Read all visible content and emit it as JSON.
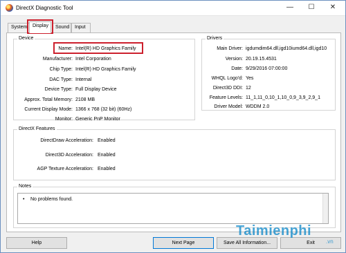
{
  "window": {
    "title": "DirectX Diagnostic Tool",
    "controls": {
      "minimize": "—",
      "maximize": "☐",
      "close": "✕"
    }
  },
  "tabs": [
    {
      "label": "System"
    },
    {
      "label": "Display",
      "active": true
    },
    {
      "label": "Sound"
    },
    {
      "label": "Input"
    }
  ],
  "device": {
    "title": "Device",
    "rows": [
      {
        "label": "Name:",
        "value": "Intel(R) HD Graphics Family"
      },
      {
        "label": "Manufacturer:",
        "value": "Intel Corporation"
      },
      {
        "label": "Chip Type:",
        "value": "Intel(R) HD Graphics Family"
      },
      {
        "label": "DAC Type:",
        "value": "Internal"
      },
      {
        "label": "Device Type:",
        "value": "Full Display Device"
      },
      {
        "label": "Approx. Total Memory:",
        "value": "2108 MB"
      },
      {
        "label": "Current Display Mode:",
        "value": "1366 x 768 (32 bit) (60Hz)"
      },
      {
        "label": "Monitor:",
        "value": "Generic PnP Monitor"
      }
    ]
  },
  "drivers": {
    "title": "Drivers",
    "rows": [
      {
        "label": "Main Driver:",
        "value": "igdumdim64.dll,igd10iumd64.dll,igd10"
      },
      {
        "label": "Version:",
        "value": "20.19.15.4531"
      },
      {
        "label": "Date:",
        "value": "9/29/2016 07:00:00"
      },
      {
        "label": "WHQL Logo'd:",
        "value": "Yes"
      },
      {
        "label": "Direct3D DDI:",
        "value": "12"
      },
      {
        "label": "Feature Levels:",
        "value": "11_1,11_0,10_1,10_0,9_3,9_2,9_1"
      },
      {
        "label": "Driver Model:",
        "value": "WDDM 2.0"
      }
    ]
  },
  "features": {
    "title": "DirectX Features",
    "rows": [
      {
        "label": "DirectDraw Acceleration:",
        "value": "Enabled"
      },
      {
        "label": "Direct3D Acceleration:",
        "value": "Enabled"
      },
      {
        "label": "AGP Texture Acceleration:",
        "value": "Enabled"
      }
    ]
  },
  "notes": {
    "title": "Notes",
    "items": [
      "No problems found."
    ]
  },
  "buttons": {
    "help": "Help",
    "next_page": "Next Page",
    "save_all": "Save All Information...",
    "exit": "Exit"
  },
  "watermark": {
    "brand": "Taimienphi",
    "suffix": ".vn"
  },
  "colors": {
    "highlight": "#cc1f2c",
    "watermark": "#0b87c9"
  }
}
